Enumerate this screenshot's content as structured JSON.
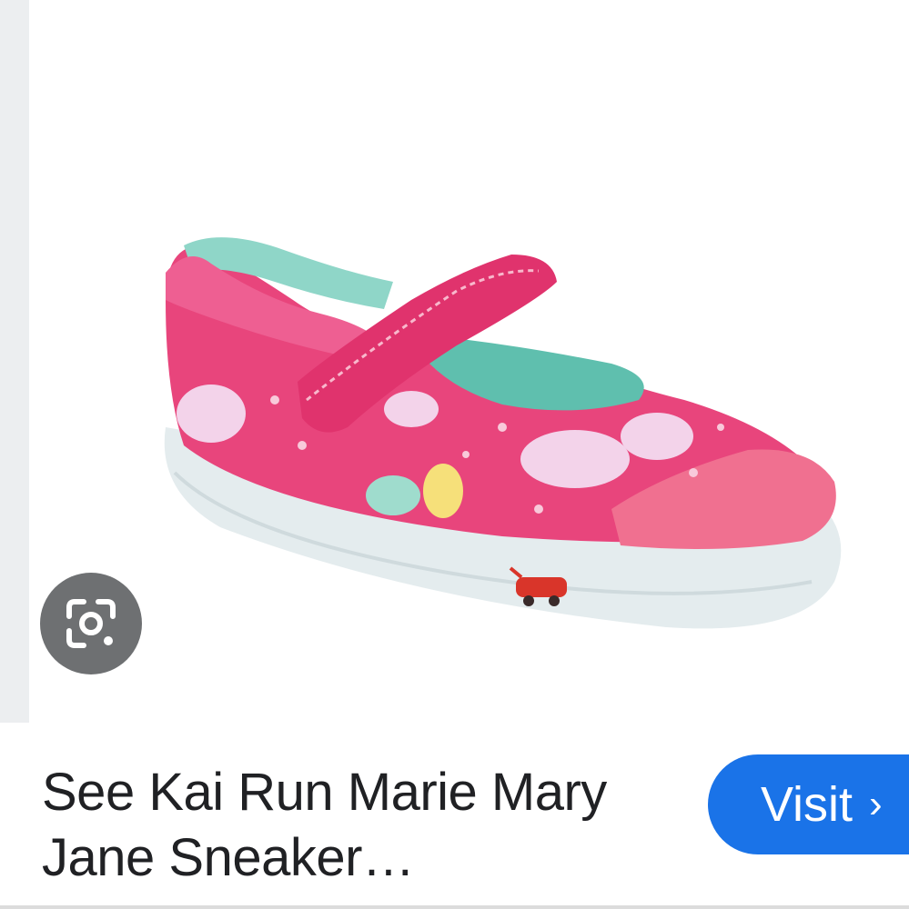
{
  "product": {
    "title_line1": "See Kai Run Marie Mary",
    "title_line2": "Jane Sneaker…",
    "image_alt": "pink mary jane sneaker"
  },
  "actions": {
    "visit_label": "Visit",
    "visit_icon": "chevron-right-icon",
    "lens_icon": "google-lens-icon"
  },
  "colors": {
    "accent": "#1a73e8",
    "lens_bg": "#6e7072",
    "shoe_pink": "#e8457c",
    "shoe_lining": "#8fd6c8",
    "sole": "#e6eef0"
  }
}
